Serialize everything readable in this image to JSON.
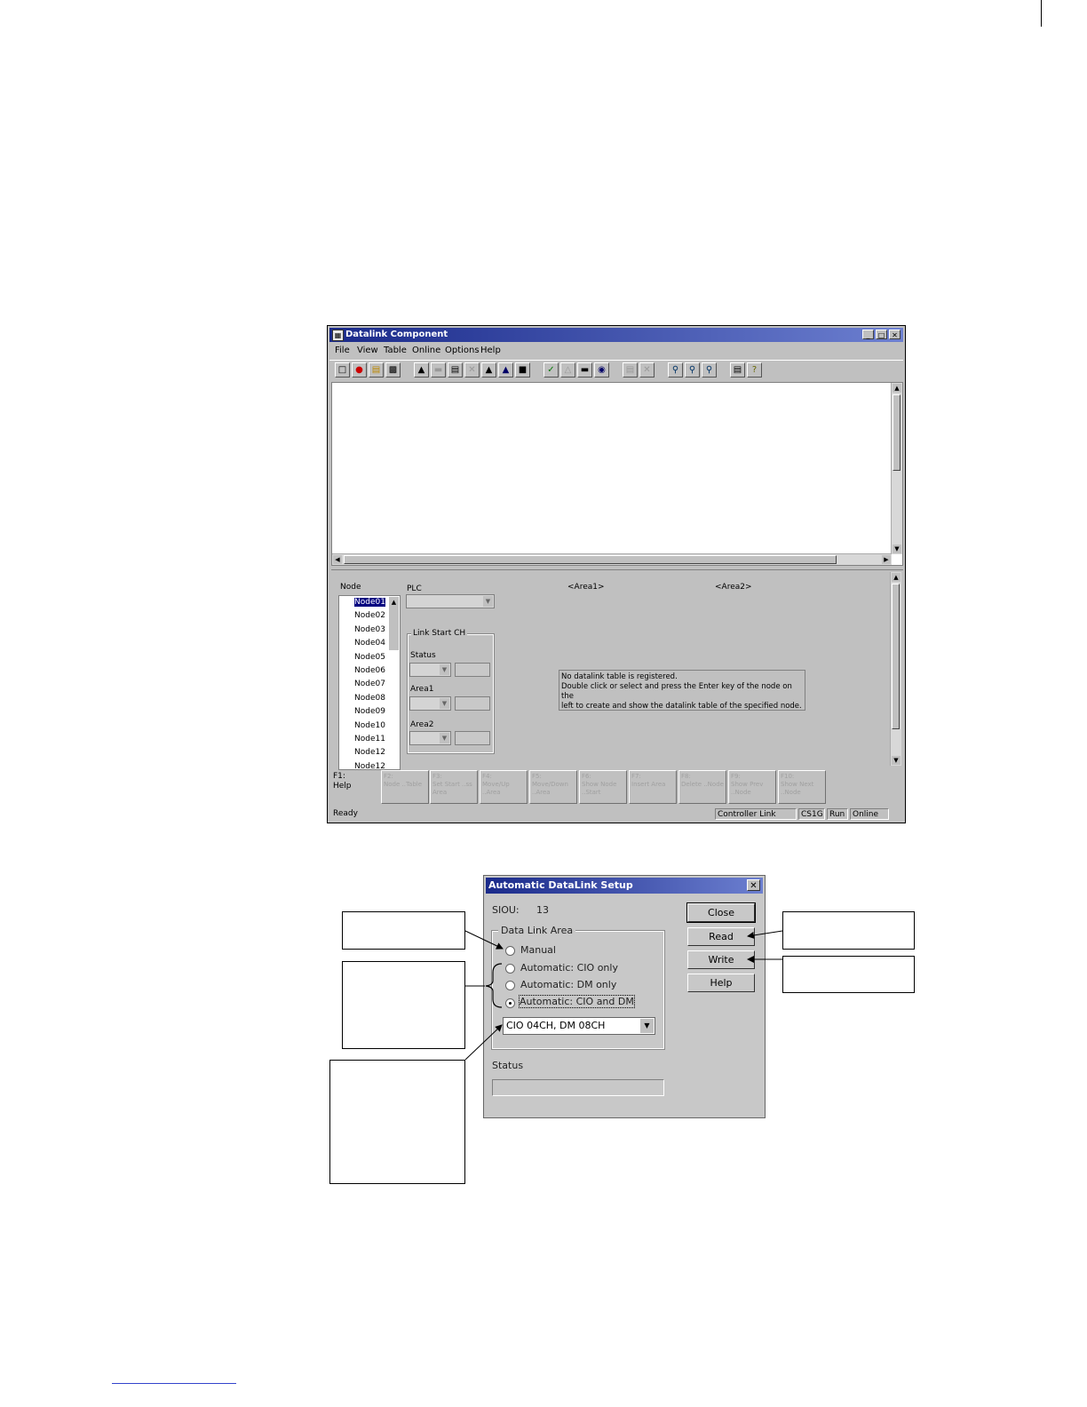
{
  "main_window": {
    "title": "Datalink Component",
    "menu": [
      "File",
      "View",
      "Table",
      "Online",
      "Options",
      "Help"
    ],
    "node_header": "Node",
    "plc_label": "PLC",
    "area1_header": "<Area1>",
    "area2_header": "<Area2>",
    "link_start_label": "Link Start CH",
    "status_label": "Status",
    "area1_label": "Area1",
    "area2_label": "Area2",
    "nodes": [
      "Node01",
      "Node02",
      "Node03",
      "Node04",
      "Node05",
      "Node06",
      "Node07",
      "Node08",
      "Node09",
      "Node10",
      "Node11",
      "Node12",
      "Node12"
    ],
    "message_lines": [
      "No datalink table is registered.",
      "Double click or select and press the Enter key of the node on the",
      "left to create and show the datalink table of the specified node."
    ],
    "fkeys": [
      {
        "key": "F1:",
        "label": "Help"
      },
      {
        "key": "F2:",
        "label": "Node ..Table"
      },
      {
        "key": "F3:",
        "label": "Set Start ..ss Area"
      },
      {
        "key": "F4:",
        "label": "Move/Up ..Area"
      },
      {
        "key": "F5:",
        "label": "Move/Down ..Area"
      },
      {
        "key": "F6:",
        "label": "Show Node ..Start"
      },
      {
        "key": "F7:",
        "label": "Insert Area"
      },
      {
        "key": "F8:",
        "label": "Delete ..Node"
      },
      {
        "key": "F9:",
        "label": "Show Prev ..Node"
      },
      {
        "key": "F10:",
        "label": "Show Next ..Node"
      }
    ],
    "status_bar": {
      "state": "Ready",
      "network": "Controller Link",
      "plc_model": "CS1G",
      "mode": "Run",
      "connection": "Online"
    }
  },
  "dialog": {
    "title": "Automatic DataLink Setup",
    "siou_label": "SIOU:",
    "siou_value": "13",
    "group_label": "Data Link Area",
    "options": [
      "Manual",
      "Automatic: CIO only",
      "Automatic: DM only",
      "Automatic: CIO and DM"
    ],
    "selected_option": "Automatic: CIO and DM",
    "combo_value": "CIO 04CH, DM 08CH",
    "status_label": "Status",
    "status_value": "",
    "buttons": [
      "Close",
      "Read",
      "Write",
      "Help"
    ]
  }
}
